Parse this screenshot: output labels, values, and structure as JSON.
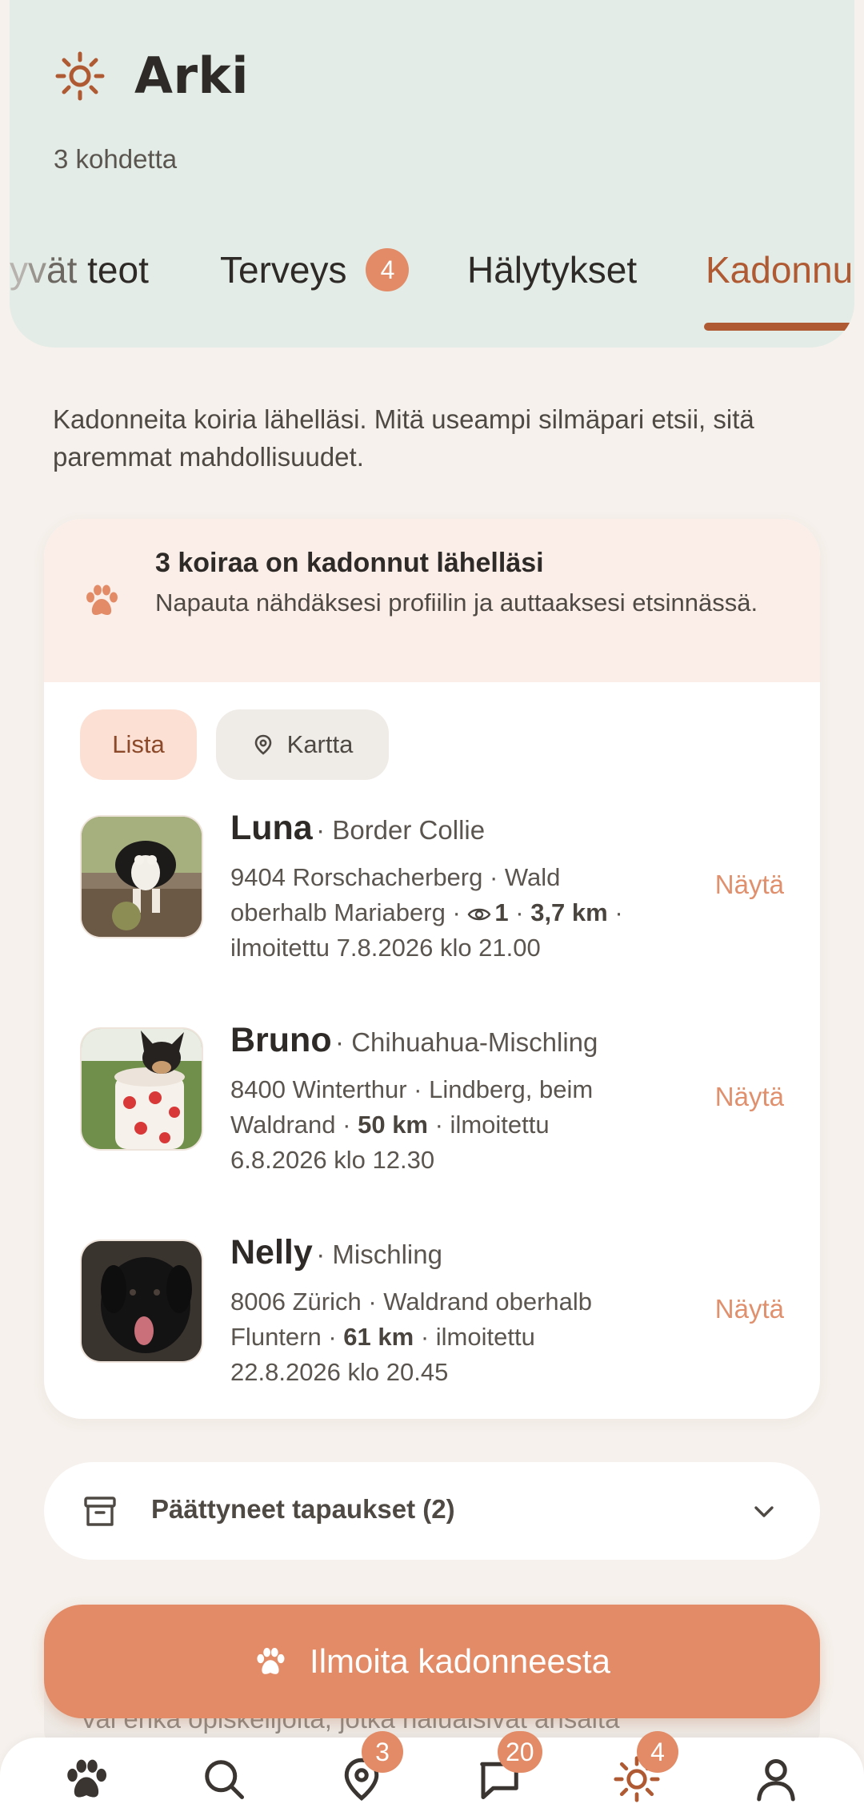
{
  "header": {
    "title": "Arki",
    "subtitle": "3 kohdetta",
    "tabs": [
      {
        "label": "yvät teot"
      },
      {
        "label": "Terveys",
        "badge": "4"
      },
      {
        "label": "Hälytykset"
      },
      {
        "label": "Kadonnu",
        "active": true
      }
    ]
  },
  "intro": "Kadonneita koiria lähelläsi. Mitä useampi silmäpari etsii, sitä paremmat mahdollisuudet.",
  "alert": {
    "title": "3 koiraa on kadonnut lähelläsi",
    "text": "Napauta nähdäksesi profiilin ja auttaaksesi etsinnässä."
  },
  "view_toggle": {
    "list": "Lista",
    "map": "Kartta"
  },
  "dogs": [
    {
      "name": "Luna",
      "breed": "· Border Collie",
      "location": "9404 Rorschacherberg · Wald oberhalb Mariaberg ·",
      "views": "1",
      "distance": "3,7 km",
      "reported": "· ilmoitettu 7.8.2026 klo 21.00",
      "action": "Näytä"
    },
    {
      "name": "Bruno",
      "breed": "· Chihuahua-Mischling",
      "location": "8400 Winterthur · Lindberg, beim Waldrand ·",
      "distance": "50 km",
      "reported": "· ilmoitettu 6.8.2026 klo 12.30",
      "action": "Näytä"
    },
    {
      "name": "Nelly",
      "breed": "· Mischling",
      "location": "8006 Zürich · Waldrand oberhalb Fluntern ·",
      "distance": "61 km",
      "reported": "· ilmoitettu 22.8.2026 klo 20.45",
      "action": "Näytä"
    }
  ],
  "closed_cases": "Päättyneet tapaukset (2)",
  "cta": "Ilmoita kadonneesta",
  "ghost_text": "Vai enkä opiskelijoita, jotka haluaisivat ansaita",
  "nav": {
    "badges": {
      "map": "3",
      "messages": "20",
      "daily": "4"
    }
  },
  "colors": {
    "accent": "#e28b66",
    "accent_dark": "#b05a33",
    "header_bg": "#e3ece7"
  }
}
